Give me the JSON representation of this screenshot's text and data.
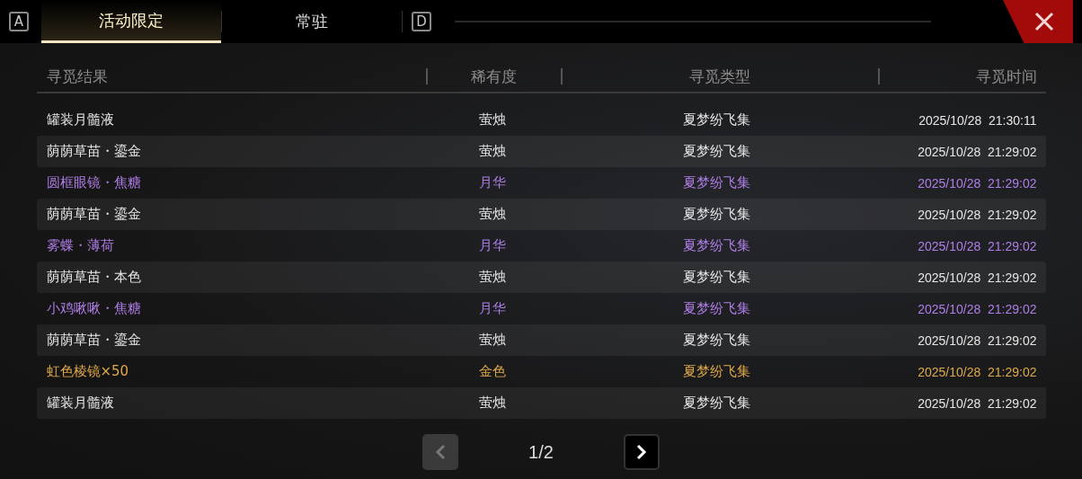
{
  "tabs": {
    "prev_key": "A",
    "items": [
      {
        "label": "活动限定",
        "selected": true
      },
      {
        "label": "常驻",
        "selected": false
      }
    ],
    "next_key": "D"
  },
  "table": {
    "columns": [
      "寻觅结果",
      "稀有度",
      "寻觅类型",
      "寻觅时间"
    ],
    "rows": [
      {
        "result": "罐装月髓液",
        "rarity": "萤烛",
        "type": "夏梦纷飞集",
        "time": "2025/10/28  21:30:11",
        "kind": "common"
      },
      {
        "result": "荫荫草苗・鎏金",
        "rarity": "萤烛",
        "type": "夏梦纷飞集",
        "time": "2025/10/28  21:29:02",
        "kind": "common"
      },
      {
        "result": "圆框眼镜・焦糖",
        "rarity": "月华",
        "type": "夏梦纷飞集",
        "time": "2025/10/28  21:29:02",
        "kind": "purple"
      },
      {
        "result": "荫荫草苗・鎏金",
        "rarity": "萤烛",
        "type": "夏梦纷飞集",
        "time": "2025/10/28  21:29:02",
        "kind": "common"
      },
      {
        "result": "雾蝶・薄荷",
        "rarity": "月华",
        "type": "夏梦纷飞集",
        "time": "2025/10/28  21:29:02",
        "kind": "purple"
      },
      {
        "result": "荫荫草苗・本色",
        "rarity": "萤烛",
        "type": "夏梦纷飞集",
        "time": "2025/10/28  21:29:02",
        "kind": "common"
      },
      {
        "result": "小鸡啾啾・焦糖",
        "rarity": "月华",
        "type": "夏梦纷飞集",
        "time": "2025/10/28  21:29:02",
        "kind": "purple"
      },
      {
        "result": "荫荫草苗・鎏金",
        "rarity": "萤烛",
        "type": "夏梦纷飞集",
        "time": "2025/10/28  21:29:02",
        "kind": "common"
      },
      {
        "result": "虹色棱镜×50",
        "rarity": "金色",
        "type": "夏梦纷飞集",
        "time": "2025/10/28  21:29:02",
        "kind": "gold"
      },
      {
        "result": "罐装月髓液",
        "rarity": "萤烛",
        "type": "夏梦纷飞集",
        "time": "2025/10/28  21:29:02",
        "kind": "common"
      }
    ]
  },
  "pagination": {
    "page": "1/2",
    "prev_disabled": true,
    "next_disabled": false
  }
}
